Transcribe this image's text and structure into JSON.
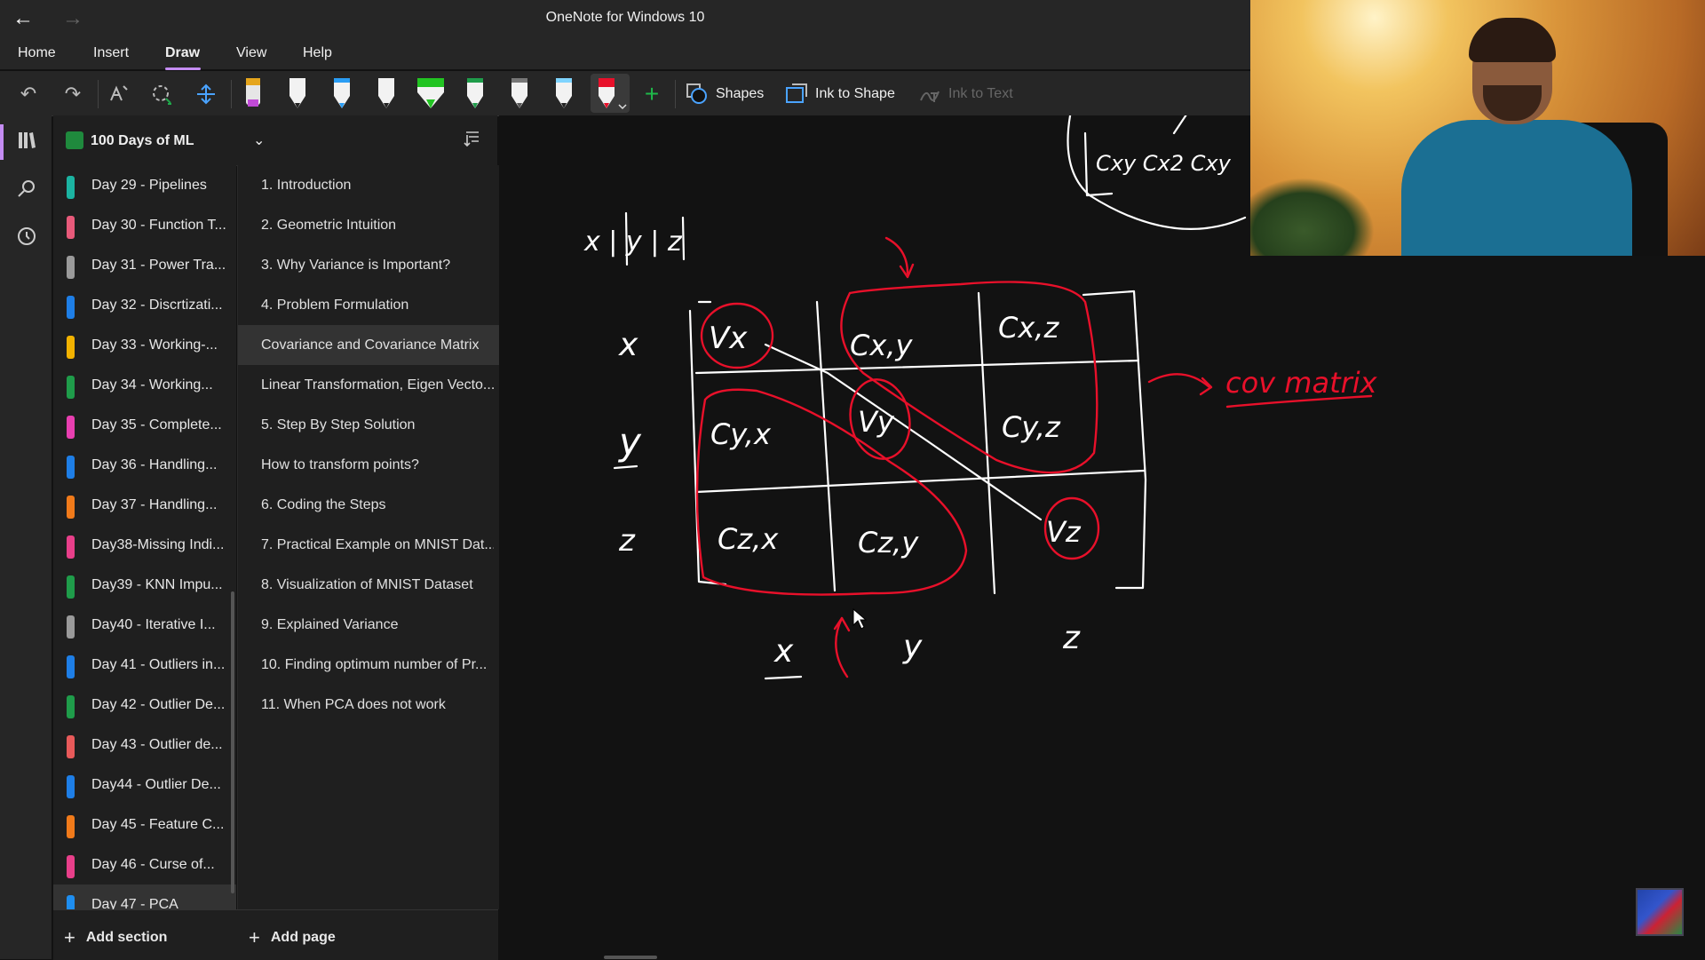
{
  "window": {
    "title": "OneNote for Windows 10"
  },
  "menu": {
    "items": [
      "Home",
      "Insert",
      "Draw",
      "View",
      "Help"
    ],
    "active": "Draw"
  },
  "ribbon": {
    "shapes_label": "Shapes",
    "ink_to_shape_label": "Ink to Shape",
    "ink_to_text_label": "Ink to Text"
  },
  "notebook": {
    "name": "100 Days of ML"
  },
  "sections": [
    {
      "label": "Day 29 - Pipelines",
      "color": "#1bb3a1"
    },
    {
      "label": "Day 30 - Function T...",
      "color": "#e85a7a"
    },
    {
      "label": "Day 31 - Power Tra...",
      "color": "#9a9a9a"
    },
    {
      "label": "Day 32 - Discrtizati...",
      "color": "#1e7ee6"
    },
    {
      "label": "Day 33 - Working-...",
      "color": "#f2b200"
    },
    {
      "label": "Day 34 - Working...",
      "color": "#1f9c4a"
    },
    {
      "label": "Day 35 - Complete...",
      "color": "#e83fb0"
    },
    {
      "label": "Day 36 - Handling...",
      "color": "#1e7ee6"
    },
    {
      "label": "Day 37 - Handling...",
      "color": "#f07a1a"
    },
    {
      "label": "Day38-Missing Indi...",
      "color": "#e83f8a"
    },
    {
      "label": "Day39 - KNN Impu...",
      "color": "#1f9c4a"
    },
    {
      "label": "Day40 - Iterative I...",
      "color": "#9a9a9a"
    },
    {
      "label": "Day 41 - Outliers in...",
      "color": "#1e7ee6"
    },
    {
      "label": "Day 42 - Outlier De...",
      "color": "#1f9c4a"
    },
    {
      "label": "Day 43 - Outlier de...",
      "color": "#e85a5a"
    },
    {
      "label": "Day44 - Outlier De...",
      "color": "#1e7ee6"
    },
    {
      "label": "Day 45 - Feature C...",
      "color": "#f07a1a"
    },
    {
      "label": "Day 46 - Curse of...",
      "color": "#e83f8a"
    },
    {
      "label": "Day 47 - PCA",
      "color": "#1e8ef0"
    }
  ],
  "active_section": "Day 47 - PCA",
  "pages": [
    "1. Introduction",
    "2. Geometric Intuition",
    "3. Why Variance is Important?",
    "4. Problem Formulation",
    "Covariance and Covariance Matrix",
    "Linear Transformation, Eigen Vecto...",
    "5. Step By Step Solution",
    "How to transform points?",
    "6. Coding the Steps",
    "7. Practical Example on MNIST Dat...",
    "8. Visualization of MNIST Dataset",
    "9. Explained Variance",
    "10. Finding optimum number of Pr...",
    "11. When PCA does not work"
  ],
  "active_page": "Covariance and Covariance Matrix",
  "footer": {
    "add_section": "Add section",
    "add_page": "Add page"
  },
  "ink_text": {
    "header": "x | y | z",
    "row_x": "x",
    "row_y": "y",
    "row_z": "z",
    "cells": {
      "r1c1": "Vx",
      "r1c2": "Cx,y",
      "r1c3": "Cx,z",
      "r2c1": "Cy,x",
      "r2c2": "Vy",
      "r2c3": "Cy,z",
      "r3c1": "Cz,x",
      "r3c2": "Cz,y",
      "r3c3": "Vz"
    },
    "col_x": "x",
    "col_y": "y",
    "col_z": "z",
    "annotation": "cov matrix",
    "partial_top": "Cxy  Cx2  Cxy"
  },
  "colors": {
    "accent": "#c48cf2",
    "ink_white": "#ffffff",
    "ink_red": "#e8102a"
  }
}
